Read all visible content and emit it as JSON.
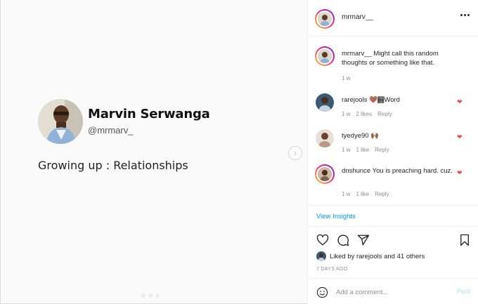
{
  "post": {
    "author_name": "Marvin Serwanga",
    "author_handle": "@mrmarv_",
    "text": "Growing up : Relationships"
  },
  "header": {
    "username": "mrmarv__"
  },
  "caption": {
    "user": "mrmarv__",
    "text": " Might call this random thoughts or something like that.",
    "time": "1 w"
  },
  "comments": [
    {
      "user": "rarejools",
      "text": "🤎🏾Word",
      "time": "1 w",
      "likes": "2 likes",
      "reply": "Reply"
    },
    {
      "user": "tyedye90",
      "text": "🙌🏾",
      "time": "1 w",
      "likes": "1 like",
      "reply": "Reply"
    },
    {
      "user": "dnshunce",
      "text": "You is preaching hard. cuz.",
      "time": "1 w",
      "likes": "1 like",
      "reply": "Reply"
    }
  ],
  "insights": {
    "label": "View Insights"
  },
  "likes": {
    "prefix": "Liked by ",
    "user": "rarejools",
    "and": " and ",
    "others": "41 others"
  },
  "date": "7 DAYS AGO",
  "add_comment": {
    "placeholder": "Add a comment...",
    "post_label": "Post"
  },
  "colors": {
    "link": "#0095f6",
    "heart": "#ed4956",
    "post_disabled": "#b2dffc"
  }
}
